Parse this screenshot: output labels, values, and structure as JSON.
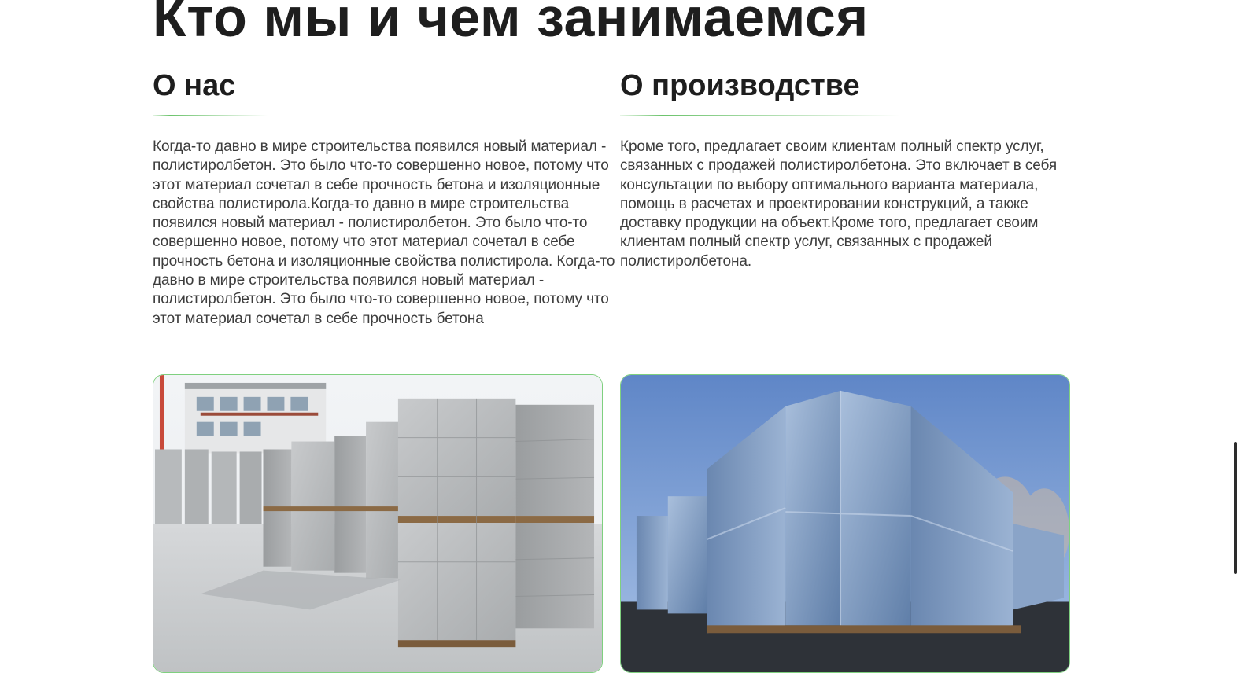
{
  "section": {
    "title": "Кто мы и чем занимаемся"
  },
  "about": {
    "heading": "О нас",
    "text": "Когда-то давно в мире строительства появился новый материал - полистиролбетон. Это было что-то совершенно новое, потому что этот материал сочетал в себе прочность бетона и изоляционные свойства полистирола.Когда-то давно в мире строительства появился новый материал - полистиролбетон. Это было что-то совершенно новое, потому что этот материал сочетал в себе прочность бетона и изоляционные свойства полистирола. Когда-то давно в мире строительства появился новый материал - полистиролбетон. Это было что-то совершенно новое, потому что этот материал сочетал в себе прочность бетона"
  },
  "production": {
    "heading": "О производстве",
    "text": "Кроме того, предлагает своим клиентам полный спектр услуг, связанных с продажей полистиролбетона. Это включает в себя консультации по выбору оптимального варианта материала, помощь в расчетах и проектировании конструкций, а также доставку продукции на объект.Кроме того, предлагает своим клиентам полный спектр услуг, связанных с продажей полистиролбетона."
  },
  "colors": {
    "accent_green": "#6cc36c",
    "text_dark": "#1e1e1e",
    "text_body": "#3d3d3d"
  }
}
